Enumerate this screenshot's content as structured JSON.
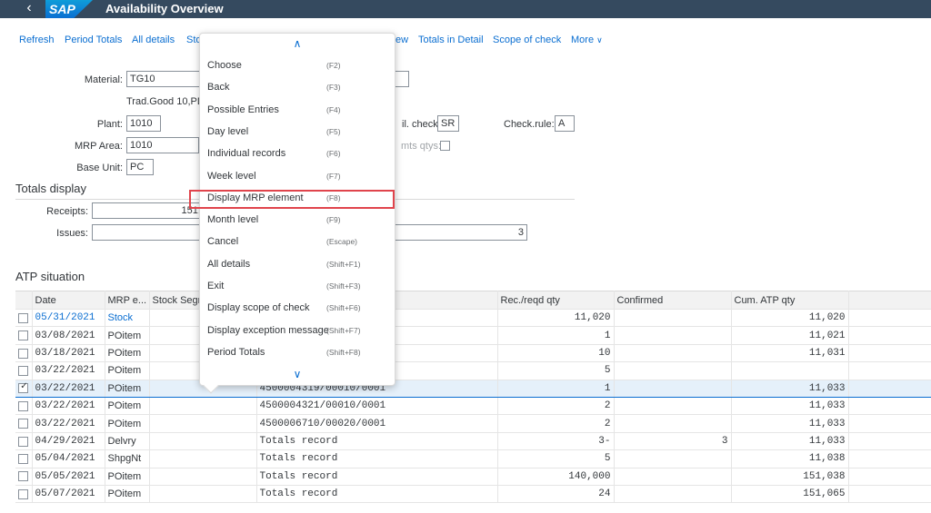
{
  "shell": {
    "back_icon": "chevron-left-icon",
    "logo": "SAP",
    "title": "Availability Overview"
  },
  "toolbar": {
    "refresh": "Refresh",
    "period_totals": "Period Totals",
    "all_details": "All details",
    "stock_partial": "Sto",
    "view_partial": "ew",
    "totals_in_detail": "Totals in Detail",
    "scope_of_check": "Scope of check",
    "more": "More",
    "more_icon": "chevron-down-icon"
  },
  "header": {
    "material_label": "Material:",
    "material_value": "TG10",
    "material_desc": "Trad.Good 10,PD",
    "plant_label": "Plant:",
    "plant_value": "1010",
    "mrp_area_label": "MRP Area:",
    "mrp_area_value": "1010",
    "base_unit_label": "Base Unit:",
    "base_unit_value": "PC",
    "avail_check_label": "il. check:",
    "avail_check_value": "SR",
    "check_rule_label": "Check.rule:",
    "check_rule_value": "A",
    "amts_qtys_label": "mts qtys:"
  },
  "totals": {
    "title": "Totals display",
    "receipts_label": "Receipts:",
    "receipts_value": "151,0",
    "issues_label": "Issues:",
    "issues_value": "3"
  },
  "atp": {
    "title": "ATP situation",
    "columns": [
      "Date",
      "MRP e...",
      "Stock Segm",
      "Rec./reqd qty",
      "Confirmed",
      "Cum. ATP qty"
    ],
    "rows": [
      {
        "checked": false,
        "date": "05/31/2021",
        "mrp": "Stock",
        "element": "",
        "qty": "11,020",
        "confirmed": "",
        "cum": "11,020",
        "link": true
      },
      {
        "checked": false,
        "date": "03/08/2021",
        "mrp": "POitem",
        "element": "",
        "qty": "1",
        "confirmed": "",
        "cum": "11,021"
      },
      {
        "checked": false,
        "date": "03/18/2021",
        "mrp": "POitem",
        "element": "",
        "qty": "10",
        "confirmed": "",
        "cum": "11,031"
      },
      {
        "checked": false,
        "date": "03/22/2021",
        "mrp": "POitem",
        "element": "",
        "qty": "5",
        "confirmed": "",
        "cum": ""
      },
      {
        "checked": true,
        "date": "03/22/2021",
        "mrp": "POitem",
        "element": "4500004319/00010/0001",
        "qty": "1",
        "confirmed": "",
        "cum": "11,033"
      },
      {
        "checked": false,
        "date": "03/22/2021",
        "mrp": "POitem",
        "element": "4500004321/00010/0001",
        "qty": "2",
        "confirmed": "",
        "cum": "11,033"
      },
      {
        "checked": false,
        "date": "03/22/2021",
        "mrp": "POitem",
        "element": "4500006710/00020/0001",
        "qty": "2",
        "confirmed": "",
        "cum": "11,033"
      },
      {
        "checked": false,
        "date": "04/29/2021",
        "mrp": "Delvry",
        "element": "Totals record",
        "qty": "3-",
        "confirmed": "3",
        "cum": "11,033"
      },
      {
        "checked": false,
        "date": "05/04/2021",
        "mrp": "ShpgNt",
        "element": "Totals record",
        "qty": "5",
        "confirmed": "",
        "cum": "11,038"
      },
      {
        "checked": false,
        "date": "05/05/2021",
        "mrp": "POitem",
        "element": "Totals record",
        "qty": "140,000",
        "confirmed": "",
        "cum": "151,038"
      },
      {
        "checked": false,
        "date": "05/07/2021",
        "mrp": "POitem",
        "element": "Totals record",
        "qty": "24",
        "confirmed": "",
        "cum": "151,065"
      }
    ]
  },
  "menu": {
    "scroll_up_icon": "chevron-up-icon",
    "scroll_down_icon": "chevron-down-icon",
    "items": [
      {
        "label": "Choose",
        "key": "(F2)"
      },
      {
        "label": "Back",
        "key": "(F3)"
      },
      {
        "label": "Possible Entries",
        "key": "(F4)"
      },
      {
        "label": "Day level",
        "key": "(F5)"
      },
      {
        "label": "Individual records",
        "key": "(F6)"
      },
      {
        "label": "Week level",
        "key": "(F7)"
      },
      {
        "label": "Display MRP element",
        "key": "(F8)"
      },
      {
        "label": "Month level",
        "key": "(F9)"
      },
      {
        "label": "Cancel",
        "key": "(Escape)"
      },
      {
        "label": "All details",
        "key": "(Shift+F1)"
      },
      {
        "label": "Exit",
        "key": "(Shift+F3)"
      },
      {
        "label": "Display scope of check",
        "key": "(Shift+F6)"
      },
      {
        "label": "Display exception message",
        "key": "(Shift+F7)"
      },
      {
        "label": "Period Totals",
        "key": "(Shift+F8)"
      }
    ]
  },
  "colors": {
    "shell": "#354a5f",
    "link": "#0a6ed1",
    "highlight": "#e0444c"
  }
}
